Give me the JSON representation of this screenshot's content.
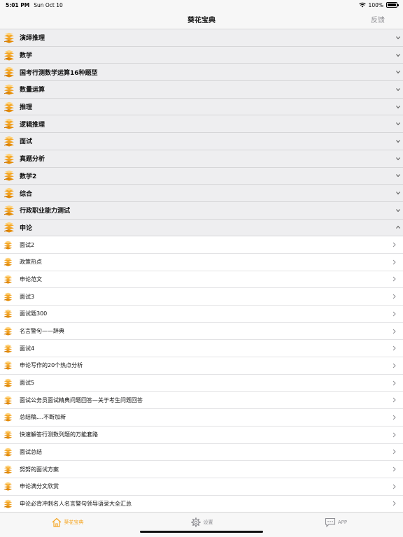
{
  "status_bar": {
    "time": "5:01 PM",
    "date": "Sun Oct 10",
    "battery": "100%",
    "battery_level": 1.0
  },
  "nav": {
    "title": "葵花宝典",
    "feedback": "反馈"
  },
  "colors": {
    "accent": "#f5a623",
    "chevron": "#8e8e93"
  },
  "sections": [
    {
      "label": "演绎推理"
    },
    {
      "label": "数学"
    },
    {
      "label": "国考行测数学运算16种题型"
    },
    {
      "label": "数量运算"
    },
    {
      "label": "推理"
    },
    {
      "label": "逻辑推理"
    },
    {
      "label": "面试"
    },
    {
      "label": "真题分析"
    },
    {
      "label": "数学2"
    },
    {
      "label": "综合"
    },
    {
      "label": "行政职业能力测试"
    },
    {
      "label": "申论"
    }
  ],
  "expanded_items": [
    {
      "label": "面试2"
    },
    {
      "label": "政策热点"
    },
    {
      "label": "申论范文"
    },
    {
      "label": "面试3"
    },
    {
      "label": "面试题300"
    },
    {
      "label": "名言警句——辞典"
    },
    {
      "label": "面试4"
    },
    {
      "label": "申论写作的20个热点分析"
    },
    {
      "label": "面试5"
    },
    {
      "label": "面试公务员面试精典问题回答—关于考生问题回答"
    },
    {
      "label": "总结稿....不断加新"
    },
    {
      "label": "快速解答行测数列题的万能套路"
    },
    {
      "label": "面试总结"
    },
    {
      "label": "努努的面试方案"
    },
    {
      "label": "申论满分文欣赏"
    },
    {
      "label": "申论必背冲刺名人名言警句领导语录大全汇总"
    }
  ],
  "tabs": [
    {
      "label": "葵花宝典",
      "icon": "home-icon",
      "active": true
    },
    {
      "label": "设置",
      "icon": "gear-icon",
      "active": false
    },
    {
      "label": "APP",
      "icon": "chat-icon",
      "active": false
    }
  ]
}
